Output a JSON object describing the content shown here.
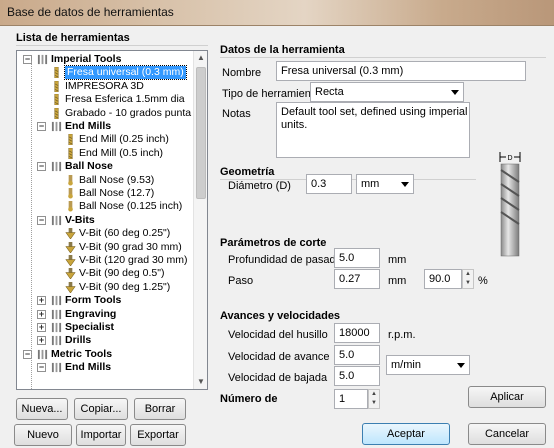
{
  "window": {
    "title": "Base de datos de herramientas"
  },
  "left": {
    "title": "Lista de herramientas",
    "tree": [
      {
        "label": "Imperial Tools",
        "bold": true,
        "level": 0,
        "icon": "folder-tools-icon",
        "expander": "−"
      },
      {
        "label": "Fresa universal (0.3 mm)",
        "level": 1,
        "icon": "end-mill-icon",
        "selected": true
      },
      {
        "label": "IMPRESORA 3D",
        "level": 1,
        "icon": "end-mill-icon"
      },
      {
        "label": "Fresa Esferica 1.5mm dia",
        "level": 1,
        "icon": "end-mill-icon"
      },
      {
        "label": "Grabado - 10 grados punta 0.4",
        "level": 1,
        "icon": "end-mill-icon"
      },
      {
        "label": "End Mills",
        "bold": true,
        "level": 1,
        "icon": "folder-tools-icon",
        "expander": "−"
      },
      {
        "label": "End Mill (0.25 inch)",
        "level": 2,
        "icon": "end-mill-icon"
      },
      {
        "label": "End Mill (0.5 inch)",
        "level": 2,
        "icon": "end-mill-icon"
      },
      {
        "label": "Ball Nose",
        "bold": true,
        "level": 1,
        "icon": "folder-tools-icon",
        "expander": "−"
      },
      {
        "label": "Ball Nose (9.53)",
        "level": 2,
        "icon": "ball-nose-icon"
      },
      {
        "label": "Ball Nose (12.7)",
        "level": 2,
        "icon": "ball-nose-icon"
      },
      {
        "label": "Ball Nose (0.125 inch)",
        "level": 2,
        "icon": "ball-nose-icon"
      },
      {
        "label": "V-Bits",
        "bold": true,
        "level": 1,
        "icon": "folder-tools-icon",
        "expander": "−"
      },
      {
        "label": "V-Bit (60 deg 0.25\")",
        "level": 2,
        "icon": "v-bit-icon"
      },
      {
        "label": "V-Bit (90 grad 30 mm)",
        "level": 2,
        "icon": "v-bit-icon"
      },
      {
        "label": "V-Bit (120 grad 30 mm)",
        "level": 2,
        "icon": "v-bit-icon"
      },
      {
        "label": "V-Bit (90 deg 0.5\")",
        "level": 2,
        "icon": "v-bit-icon"
      },
      {
        "label": "V-Bit (90 deg 1.25\")",
        "level": 2,
        "icon": "v-bit-icon"
      },
      {
        "label": "Form Tools",
        "bold": true,
        "level": 1,
        "icon": "folder-tools-icon",
        "expander": "+"
      },
      {
        "label": "Engraving",
        "bold": true,
        "level": 1,
        "icon": "folder-tools-icon",
        "expander": "+"
      },
      {
        "label": "Specialist",
        "bold": true,
        "level": 1,
        "icon": "folder-tools-icon",
        "expander": "+"
      },
      {
        "label": "Drills",
        "bold": true,
        "level": 1,
        "icon": "folder-tools-icon",
        "expander": "+"
      },
      {
        "label": "Metric Tools",
        "bold": true,
        "level": 0,
        "icon": "folder-tools-icon",
        "expander": "−"
      },
      {
        "label": "End Mills",
        "bold": true,
        "level": 1,
        "icon": "folder-tools-icon",
        "expander": "−"
      }
    ],
    "buttons": {
      "new": "Nueva...",
      "copy": "Copiar...",
      "delete": "Borrar",
      "new_group": "Nuevo Grupo",
      "import": "Importar",
      "export": "Exportar"
    }
  },
  "right": {
    "tool_data": {
      "title": "Datos de la herramienta",
      "name_label": "Nombre",
      "name_value": "Fresa universal (0.3 mm)",
      "type_label": "Tipo de herramienta",
      "type_value": "Recta",
      "notes_label": "Notas",
      "notes_value": "Default tool set, defined using imperial units."
    },
    "geometry": {
      "title": "Geometría",
      "diameter_label": "Diámetro (D)",
      "diameter_value": "0.3",
      "units_value": "mm",
      "diagram_label": "D"
    },
    "cutting": {
      "title": "Parámetros de corte",
      "depth_label": "Profundidad de pasada",
      "depth_value": "5.0",
      "depth_unit": "mm",
      "step_label": "Paso",
      "step_value": "0.27",
      "step_unit": "mm",
      "step_percent": "90.0",
      "percent_sign": "%"
    },
    "feeds": {
      "title": "Avances y velocidades",
      "spindle_label": "Velocidad del husillo",
      "spindle_value": "18000",
      "spindle_unit": "r.p.m.",
      "feed_label": "Velocidad de avance",
      "feed_value": "5.0",
      "plunge_label": "Velocidad de bajada",
      "plunge_value": "5.0",
      "rate_units": "m/min"
    },
    "tool_number": {
      "title": "Número de",
      "value": "1"
    },
    "apply_label": "Aplicar"
  },
  "footer": {
    "accept": "Aceptar",
    "cancel": "Cancelar"
  }
}
